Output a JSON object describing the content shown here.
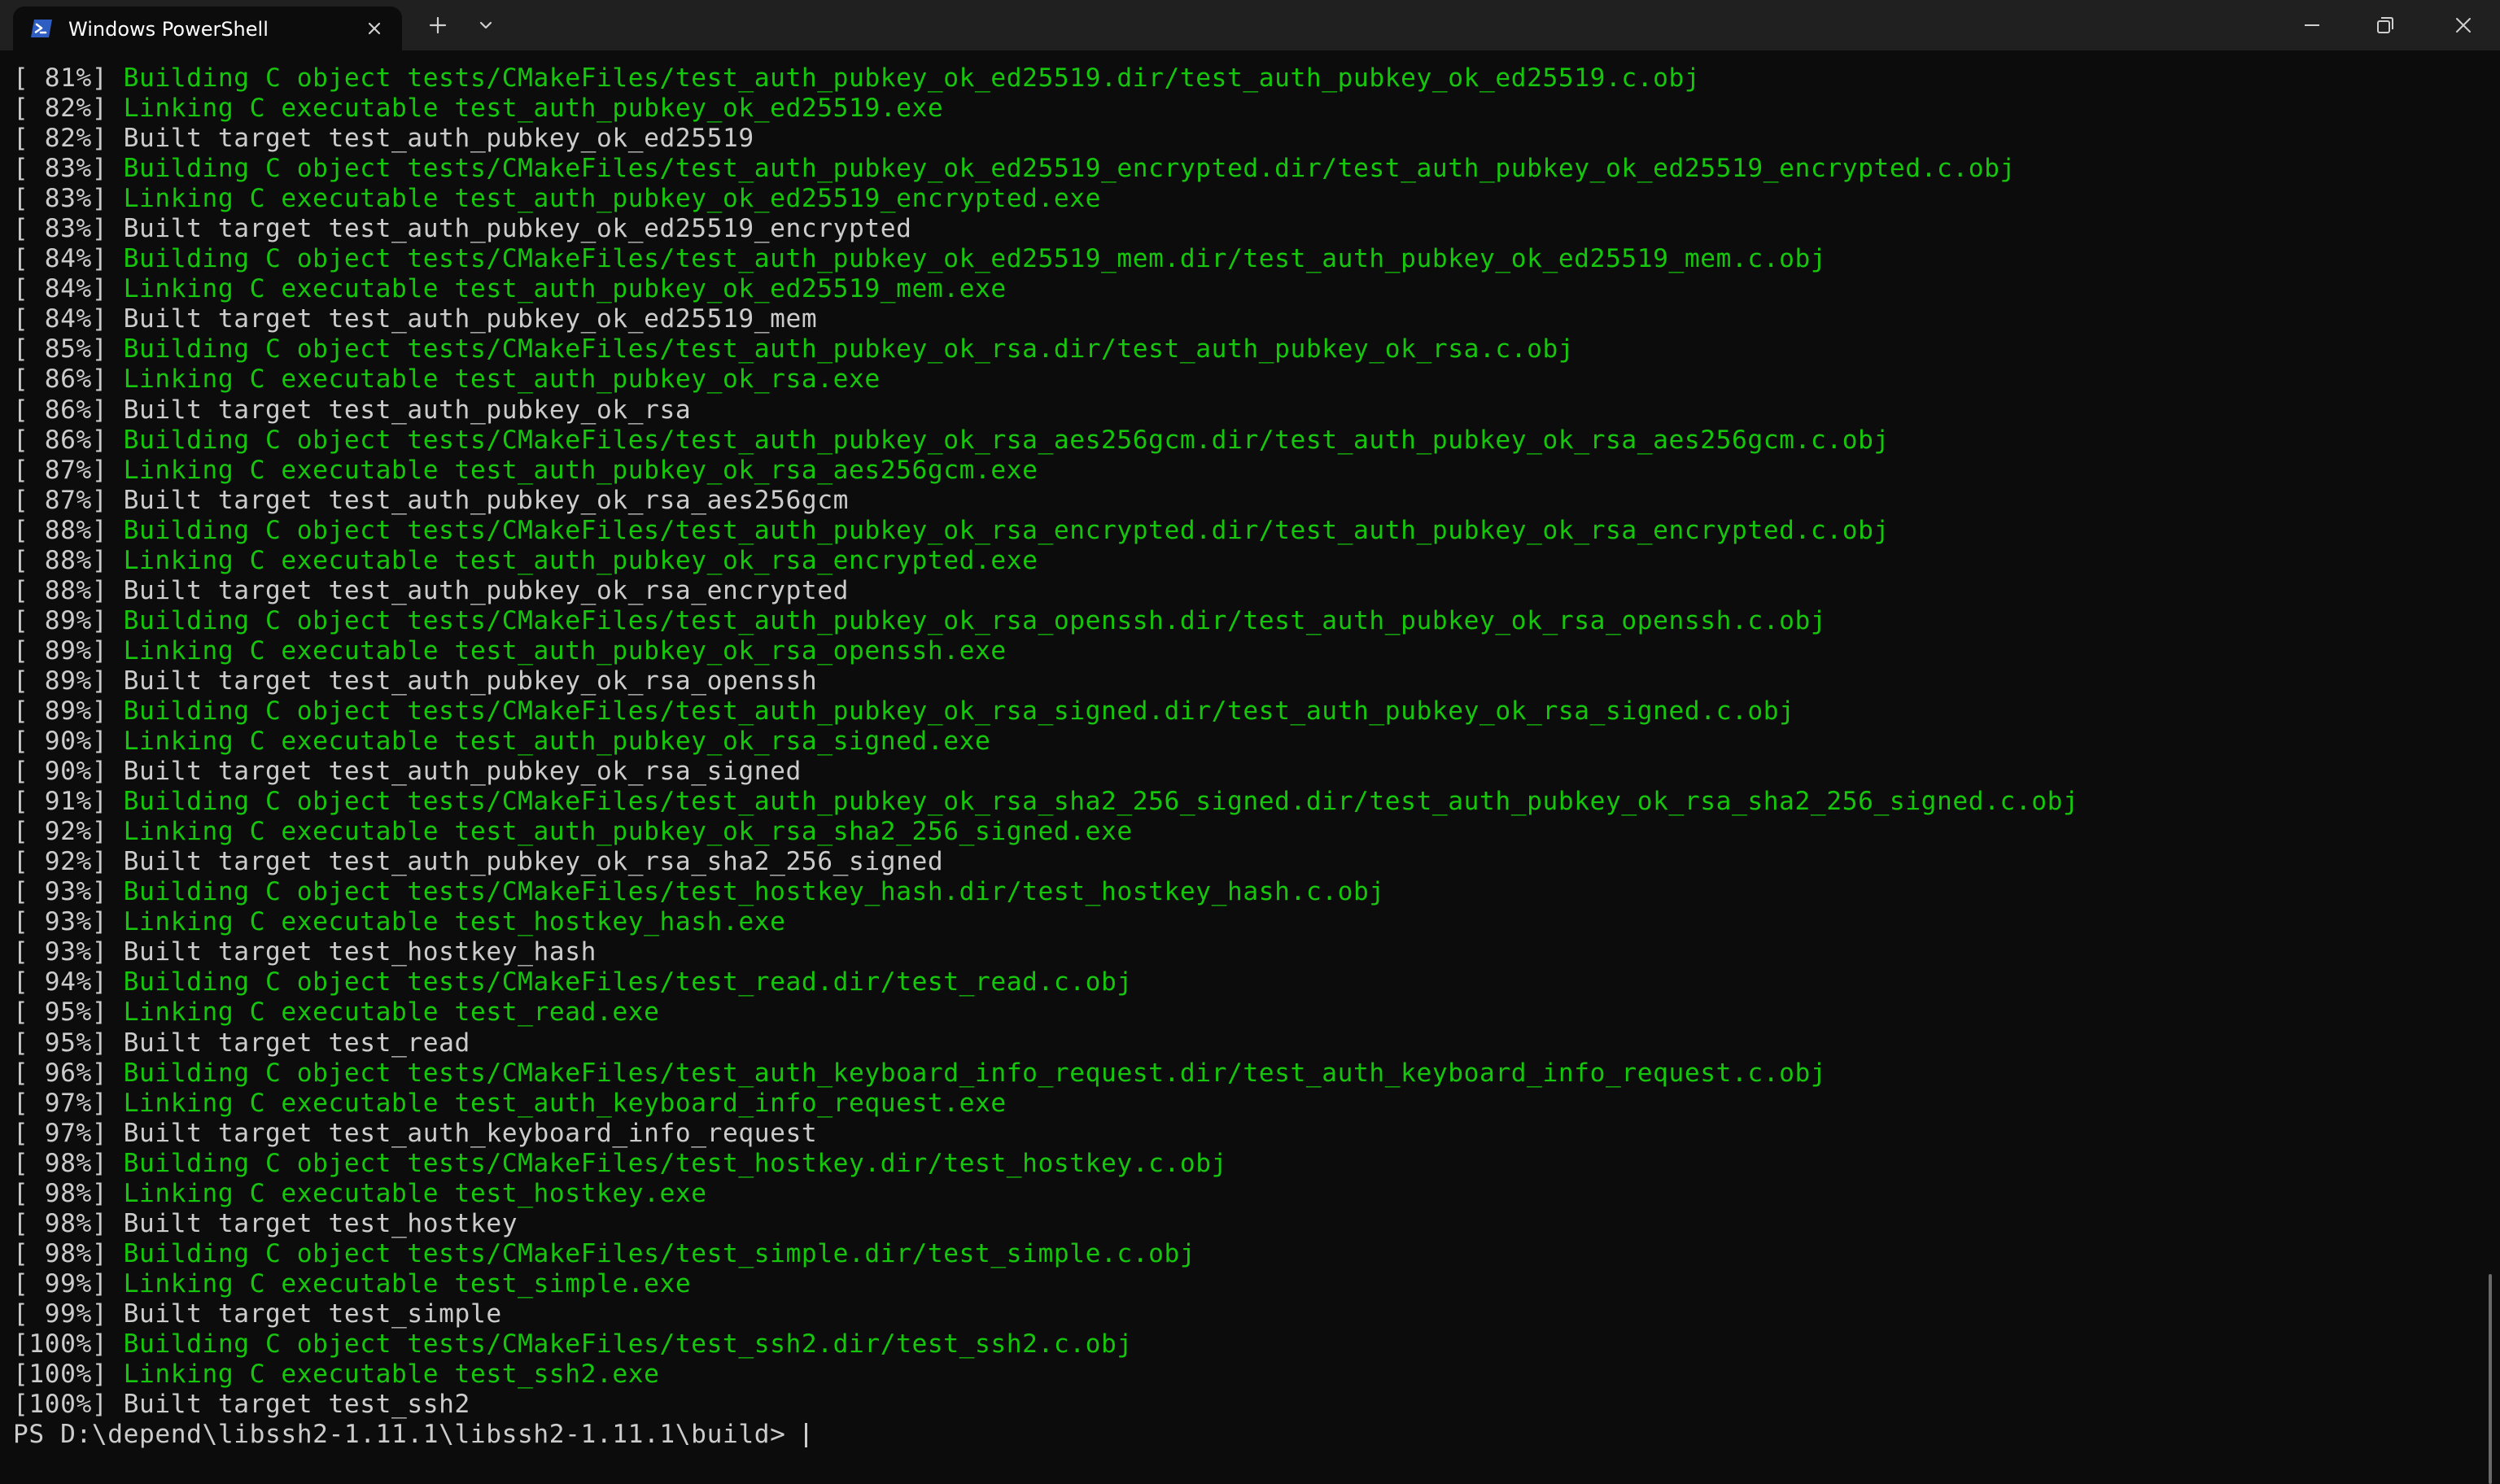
{
  "window": {
    "tab_title": "Windows PowerShell",
    "new_tab_label": "+",
    "colors": {
      "background": "#0c0c0c",
      "titlebar": "#202020",
      "green": "#16c60c",
      "text": "#cccccc",
      "ps_icon": "#2f5ec2"
    }
  },
  "terminal": {
    "lines": [
      {
        "pct": "[ 81%]",
        "msg": "Building C object tests/CMakeFiles/test_auth_pubkey_ok_ed25519.dir/test_auth_pubkey_ok_ed25519.c.obj",
        "color": "green"
      },
      {
        "pct": "[ 82%]",
        "msg": "Linking C executable test_auth_pubkey_ok_ed25519.exe",
        "color": "green"
      },
      {
        "pct": "[ 82%]",
        "msg": "Built target test_auth_pubkey_ok_ed25519",
        "color": "white"
      },
      {
        "pct": "[ 83%]",
        "msg": "Building C object tests/CMakeFiles/test_auth_pubkey_ok_ed25519_encrypted.dir/test_auth_pubkey_ok_ed25519_encrypted.c.obj",
        "color": "green"
      },
      {
        "pct": "[ 83%]",
        "msg": "Linking C executable test_auth_pubkey_ok_ed25519_encrypted.exe",
        "color": "green"
      },
      {
        "pct": "[ 83%]",
        "msg": "Built target test_auth_pubkey_ok_ed25519_encrypted",
        "color": "white"
      },
      {
        "pct": "[ 84%]",
        "msg": "Building C object tests/CMakeFiles/test_auth_pubkey_ok_ed25519_mem.dir/test_auth_pubkey_ok_ed25519_mem.c.obj",
        "color": "green"
      },
      {
        "pct": "[ 84%]",
        "msg": "Linking C executable test_auth_pubkey_ok_ed25519_mem.exe",
        "color": "green"
      },
      {
        "pct": "[ 84%]",
        "msg": "Built target test_auth_pubkey_ok_ed25519_mem",
        "color": "white"
      },
      {
        "pct": "[ 85%]",
        "msg": "Building C object tests/CMakeFiles/test_auth_pubkey_ok_rsa.dir/test_auth_pubkey_ok_rsa.c.obj",
        "color": "green"
      },
      {
        "pct": "[ 86%]",
        "msg": "Linking C executable test_auth_pubkey_ok_rsa.exe",
        "color": "green"
      },
      {
        "pct": "[ 86%]",
        "msg": "Built target test_auth_pubkey_ok_rsa",
        "color": "white"
      },
      {
        "pct": "[ 86%]",
        "msg": "Building C object tests/CMakeFiles/test_auth_pubkey_ok_rsa_aes256gcm.dir/test_auth_pubkey_ok_rsa_aes256gcm.c.obj",
        "color": "green"
      },
      {
        "pct": "[ 87%]",
        "msg": "Linking C executable test_auth_pubkey_ok_rsa_aes256gcm.exe",
        "color": "green"
      },
      {
        "pct": "[ 87%]",
        "msg": "Built target test_auth_pubkey_ok_rsa_aes256gcm",
        "color": "white"
      },
      {
        "pct": "[ 88%]",
        "msg": "Building C object tests/CMakeFiles/test_auth_pubkey_ok_rsa_encrypted.dir/test_auth_pubkey_ok_rsa_encrypted.c.obj",
        "color": "green"
      },
      {
        "pct": "[ 88%]",
        "msg": "Linking C executable test_auth_pubkey_ok_rsa_encrypted.exe",
        "color": "green"
      },
      {
        "pct": "[ 88%]",
        "msg": "Built target test_auth_pubkey_ok_rsa_encrypted",
        "color": "white"
      },
      {
        "pct": "[ 89%]",
        "msg": "Building C object tests/CMakeFiles/test_auth_pubkey_ok_rsa_openssh.dir/test_auth_pubkey_ok_rsa_openssh.c.obj",
        "color": "green"
      },
      {
        "pct": "[ 89%]",
        "msg": "Linking C executable test_auth_pubkey_ok_rsa_openssh.exe",
        "color": "green"
      },
      {
        "pct": "[ 89%]",
        "msg": "Built target test_auth_pubkey_ok_rsa_openssh",
        "color": "white"
      },
      {
        "pct": "[ 89%]",
        "msg": "Building C object tests/CMakeFiles/test_auth_pubkey_ok_rsa_signed.dir/test_auth_pubkey_ok_rsa_signed.c.obj",
        "color": "green"
      },
      {
        "pct": "[ 90%]",
        "msg": "Linking C executable test_auth_pubkey_ok_rsa_signed.exe",
        "color": "green"
      },
      {
        "pct": "[ 90%]",
        "msg": "Built target test_auth_pubkey_ok_rsa_signed",
        "color": "white"
      },
      {
        "pct": "[ 91%]",
        "msg": "Building C object tests/CMakeFiles/test_auth_pubkey_ok_rsa_sha2_256_signed.dir/test_auth_pubkey_ok_rsa_sha2_256_signed.c.obj",
        "color": "green"
      },
      {
        "pct": "[ 92%]",
        "msg": "Linking C executable test_auth_pubkey_ok_rsa_sha2_256_signed.exe",
        "color": "green"
      },
      {
        "pct": "[ 92%]",
        "msg": "Built target test_auth_pubkey_ok_rsa_sha2_256_signed",
        "color": "white"
      },
      {
        "pct": "[ 93%]",
        "msg": "Building C object tests/CMakeFiles/test_hostkey_hash.dir/test_hostkey_hash.c.obj",
        "color": "green"
      },
      {
        "pct": "[ 93%]",
        "msg": "Linking C executable test_hostkey_hash.exe",
        "color": "green"
      },
      {
        "pct": "[ 93%]",
        "msg": "Built target test_hostkey_hash",
        "color": "white"
      },
      {
        "pct": "[ 94%]",
        "msg": "Building C object tests/CMakeFiles/test_read.dir/test_read.c.obj",
        "color": "green"
      },
      {
        "pct": "[ 95%]",
        "msg": "Linking C executable test_read.exe",
        "color": "green"
      },
      {
        "pct": "[ 95%]",
        "msg": "Built target test_read",
        "color": "white"
      },
      {
        "pct": "[ 96%]",
        "msg": "Building C object tests/CMakeFiles/test_auth_keyboard_info_request.dir/test_auth_keyboard_info_request.c.obj",
        "color": "green"
      },
      {
        "pct": "[ 97%]",
        "msg": "Linking C executable test_auth_keyboard_info_request.exe",
        "color": "green"
      },
      {
        "pct": "[ 97%]",
        "msg": "Built target test_auth_keyboard_info_request",
        "color": "white"
      },
      {
        "pct": "[ 98%]",
        "msg": "Building C object tests/CMakeFiles/test_hostkey.dir/test_hostkey.c.obj",
        "color": "green"
      },
      {
        "pct": "[ 98%]",
        "msg": "Linking C executable test_hostkey.exe",
        "color": "green"
      },
      {
        "pct": "[ 98%]",
        "msg": "Built target test_hostkey",
        "color": "white"
      },
      {
        "pct": "[ 98%]",
        "msg": "Building C object tests/CMakeFiles/test_simple.dir/test_simple.c.obj",
        "color": "green"
      },
      {
        "pct": "[ 99%]",
        "msg": "Linking C executable test_simple.exe",
        "color": "green"
      },
      {
        "pct": "[ 99%]",
        "msg": "Built target test_simple",
        "color": "white"
      },
      {
        "pct": "[100%]",
        "msg": "Building C object tests/CMakeFiles/test_ssh2.dir/test_ssh2.c.obj",
        "color": "green"
      },
      {
        "pct": "[100%]",
        "msg": "Linking C executable test_ssh2.exe",
        "color": "green"
      },
      {
        "pct": "[100%]",
        "msg": "Built target test_ssh2",
        "color": "white"
      }
    ],
    "prompt": "PS D:\\depend\\libssh2-1.11.1\\libssh2-1.11.1\\build> "
  }
}
